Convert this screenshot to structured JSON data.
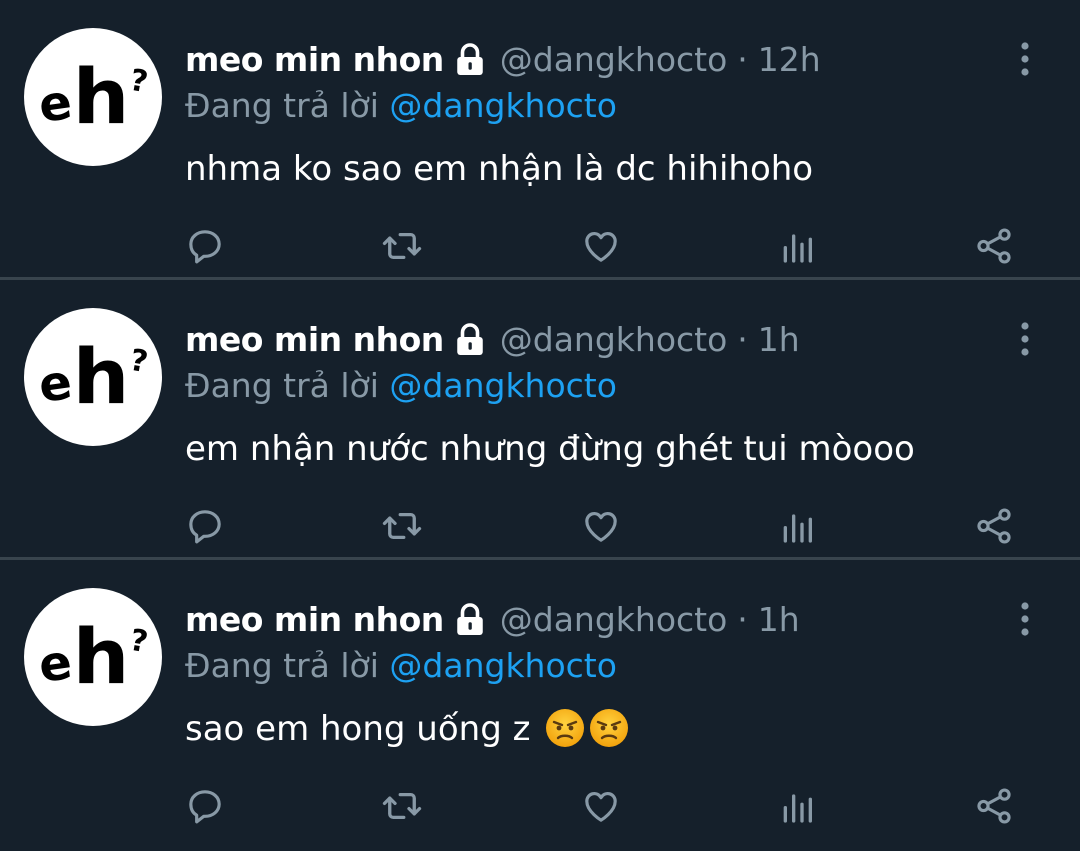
{
  "colors": {
    "background": "#15202b",
    "name": "#ffffff",
    "muted": "#8899a6",
    "mention": "#1da1f2",
    "separator": "#38444d",
    "icon": "#8899a6"
  },
  "icons": {
    "more": "more-vertical-icon",
    "lock": "lock-icon",
    "reply": "reply-icon",
    "retweet": "retweet-icon",
    "like": "like-icon",
    "analytics": "analytics-icon",
    "share": "share-icon"
  },
  "tweets": [
    {
      "avatar_text": {
        "e": "e",
        "h": "h",
        "q": "?"
      },
      "name": "meo min nhon",
      "handle": "@dangkhocto",
      "separator": "·",
      "time": "12h",
      "reply_prefix": "Đang trả lời",
      "reply_to": "@dangkhocto",
      "text": "nhma ko sao em nhận là dc hihihoho"
    },
    {
      "avatar_text": {
        "e": "e",
        "h": "h",
        "q": "?"
      },
      "name": "meo min nhon",
      "handle": "@dangkhocto",
      "separator": "·",
      "time": "1h",
      "reply_prefix": "Đang trả lời",
      "reply_to": "@dangkhocto",
      "text": "em nhận nước nhưng đừng ghét tui mòooo"
    },
    {
      "avatar_text": {
        "e": "e",
        "h": "h",
        "q": "?"
      },
      "name": "meo min nhon",
      "handle": "@dangkhocto",
      "separator": "·",
      "time": "1h",
      "reply_prefix": "Đang trả lời",
      "reply_to": "@dangkhocto",
      "text": "sao em hong uống z",
      "emojis": [
        "angry-face",
        "angry-face"
      ]
    }
  ]
}
